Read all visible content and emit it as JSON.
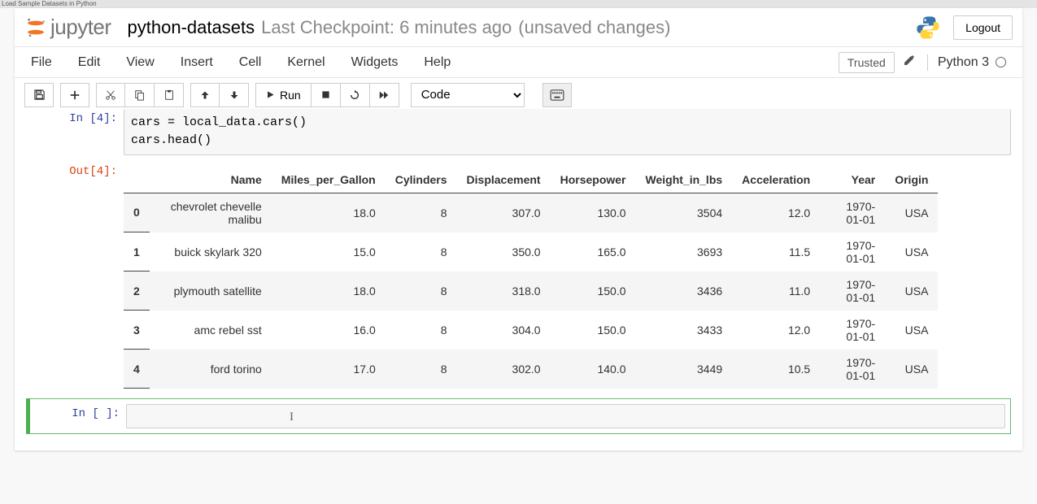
{
  "browser_tab": "Load Sample Datasets in Python",
  "header": {
    "logo_text": "jupyter",
    "notebook_name": "python-datasets",
    "checkpoint": "Last Checkpoint: 6 minutes ago",
    "unsaved": "(unsaved changes)",
    "logout": "Logout"
  },
  "menubar": {
    "items": [
      "File",
      "Edit",
      "View",
      "Insert",
      "Cell",
      "Kernel",
      "Widgets",
      "Help"
    ],
    "trusted": "Trusted",
    "kernel_name": "Python 3"
  },
  "toolbar": {
    "run_label": "Run",
    "cell_type": "Code"
  },
  "cells": {
    "in4": {
      "prompt": "In [4]:",
      "code_line1": "cars = local_data.cars()",
      "code_line2": "cars.head()"
    },
    "out4": {
      "prompt": "Out[4]:",
      "columns": [
        "Name",
        "Miles_per_Gallon",
        "Cylinders",
        "Displacement",
        "Horsepower",
        "Weight_in_lbs",
        "Acceleration",
        "Year",
        "Origin"
      ],
      "rows": [
        {
          "idx": "0",
          "Name": "chevrolet chevelle malibu",
          "Miles_per_Gallon": "18.0",
          "Cylinders": "8",
          "Displacement": "307.0",
          "Horsepower": "130.0",
          "Weight_in_lbs": "3504",
          "Acceleration": "12.0",
          "Year": "1970-01-01",
          "Origin": "USA"
        },
        {
          "idx": "1",
          "Name": "buick skylark 320",
          "Miles_per_Gallon": "15.0",
          "Cylinders": "8",
          "Displacement": "350.0",
          "Horsepower": "165.0",
          "Weight_in_lbs": "3693",
          "Acceleration": "11.5",
          "Year": "1970-01-01",
          "Origin": "USA"
        },
        {
          "idx": "2",
          "Name": "plymouth satellite",
          "Miles_per_Gallon": "18.0",
          "Cylinders": "8",
          "Displacement": "318.0",
          "Horsepower": "150.0",
          "Weight_in_lbs": "3436",
          "Acceleration": "11.0",
          "Year": "1970-01-01",
          "Origin": "USA"
        },
        {
          "idx": "3",
          "Name": "amc rebel sst",
          "Miles_per_Gallon": "16.0",
          "Cylinders": "8",
          "Displacement": "304.0",
          "Horsepower": "150.0",
          "Weight_in_lbs": "3433",
          "Acceleration": "12.0",
          "Year": "1970-01-01",
          "Origin": "USA"
        },
        {
          "idx": "4",
          "Name": "ford torino",
          "Miles_per_Gallon": "17.0",
          "Cylinders": "8",
          "Displacement": "302.0",
          "Horsepower": "140.0",
          "Weight_in_lbs": "3449",
          "Acceleration": "10.5",
          "Year": "1970-01-01",
          "Origin": "USA"
        }
      ]
    },
    "empty": {
      "prompt": "In [ ]:"
    }
  }
}
